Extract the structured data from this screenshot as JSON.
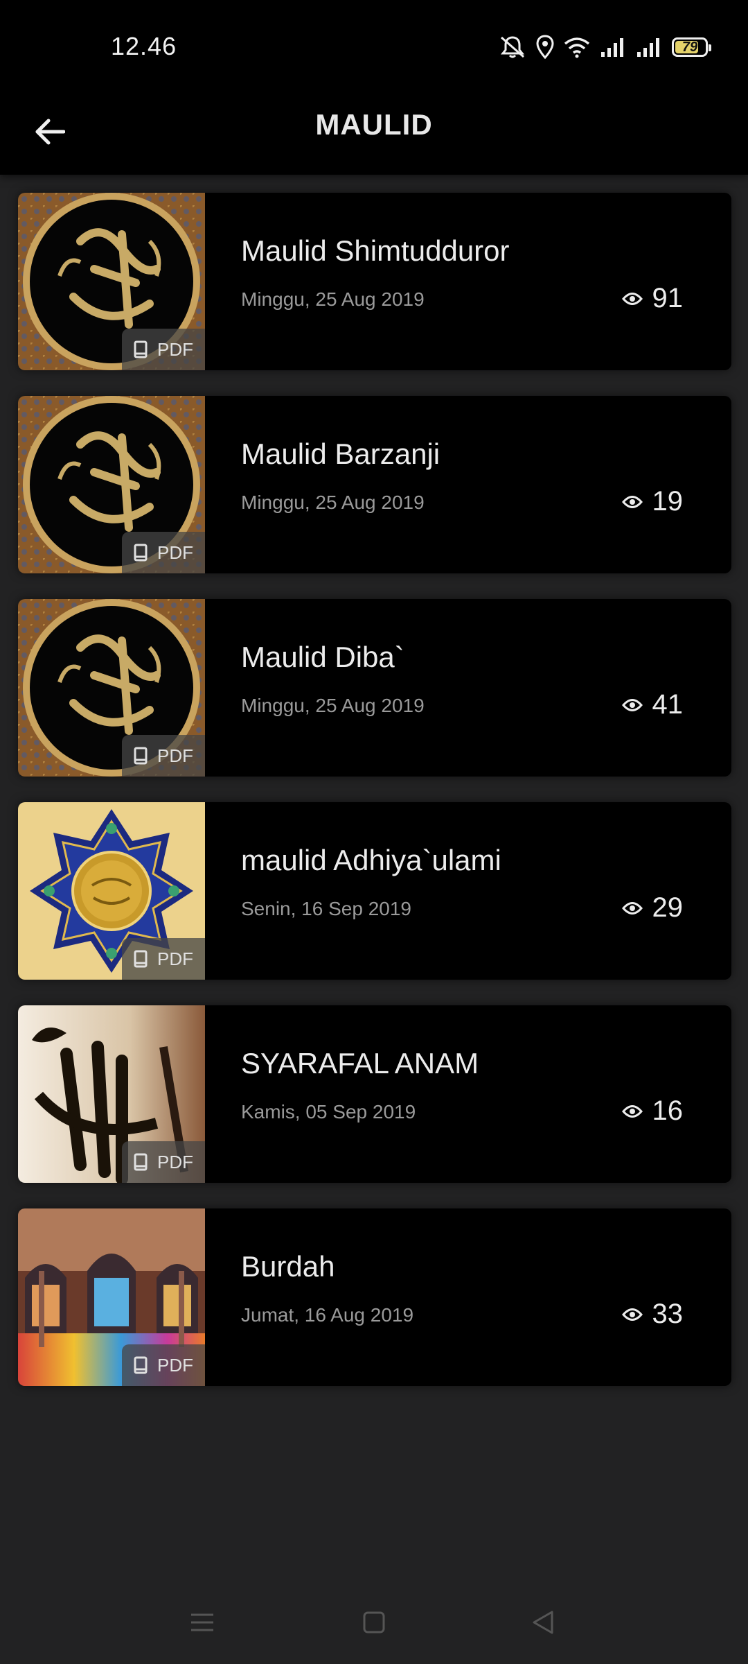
{
  "status_bar": {
    "time": "12.46",
    "battery": "79",
    "battery_level": 0.79,
    "icons": [
      "notifications-off-icon",
      "location-icon",
      "wifi-icon",
      "signal-icon",
      "signal-icon",
      "battery-icon"
    ]
  },
  "app_bar": {
    "title": "MAULID",
    "back_icon": "arrow-left-icon"
  },
  "items": [
    {
      "title": "Maulid Shimtudduror",
      "date": "Minggu, 25 Aug 2019",
      "views": "91",
      "badge": "PDF",
      "thumb": "calligraphy-muhammad"
    },
    {
      "title": "Maulid Barzanji",
      "date": "Minggu, 25 Aug 2019",
      "views": "19",
      "badge": "PDF",
      "thumb": "calligraphy-muhammad"
    },
    {
      "title": "Maulid Diba`",
      "date": "Minggu, 25 Aug 2019",
      "views": "41",
      "badge": "PDF",
      "thumb": "calligraphy-muhammad"
    },
    {
      "title": "maulid Adhiya`ulami",
      "date": "Senin, 16 Sep 2019",
      "views": "29",
      "badge": "PDF",
      "thumb": "islamic-ornament"
    },
    {
      "title": "SYARAFAL ANAM",
      "date": "Kamis, 05 Sep 2019",
      "views": "16",
      "badge": "PDF",
      "thumb": "allah-calligraphy"
    },
    {
      "title": "Burdah",
      "date": "Jumat, 16 Aug 2019",
      "views": "33",
      "badge": "PDF",
      "thumb": "mosque-interior"
    }
  ],
  "colors": {
    "background": "#222223",
    "bar": "#000000",
    "card": "#000000",
    "text": "#ececec",
    "muted": "#9a9a9a",
    "battery": "#e4d26a"
  },
  "nav": [
    "menu-icon",
    "home-square-icon",
    "back-triangle-icon"
  ]
}
